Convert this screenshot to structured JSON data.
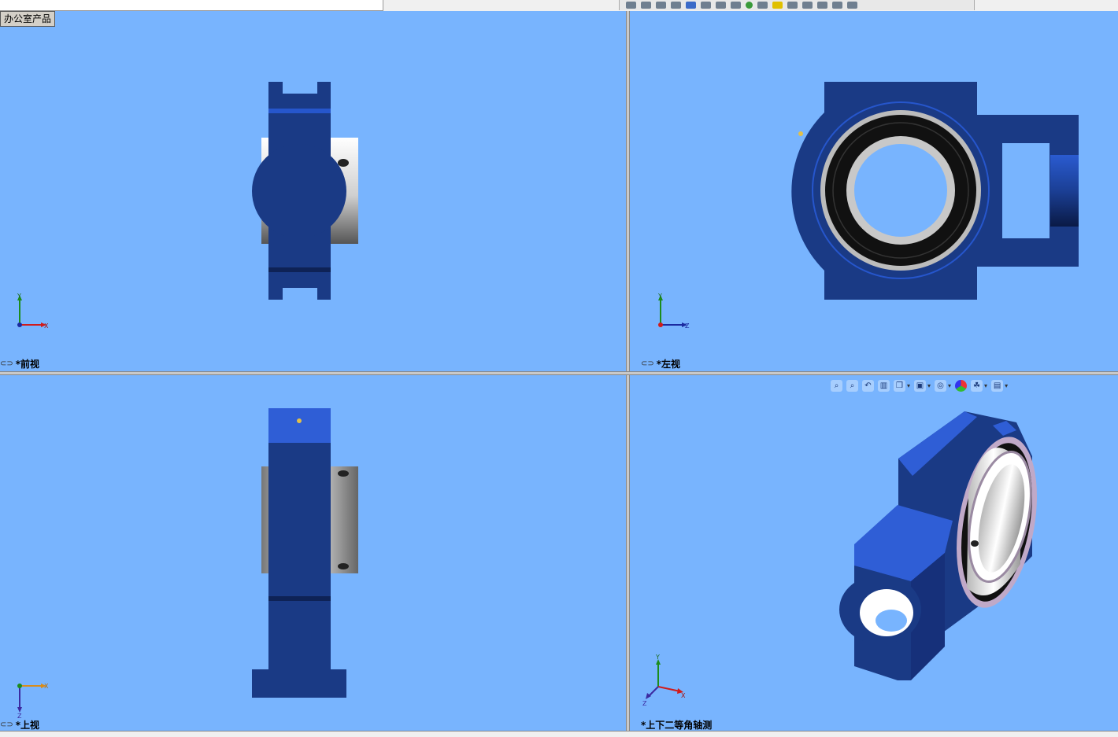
{
  "app": {
    "tag_label": "办公室产品"
  },
  "toolbar": {
    "icons": [
      "view-orient-icon",
      "section-icon",
      "display-icon",
      "hide-show-icon",
      "edit-appearance-icon",
      "scene-icon",
      "light-icon",
      "camera-icon",
      "measure-icon",
      "insert-icon",
      "zoom-icon",
      "pan-icon",
      "copy-icon",
      "paste-icon",
      "print-icon",
      "window-icon"
    ]
  },
  "viewports": {
    "front": {
      "label": "*前视",
      "axes": {
        "up": "Y",
        "right": "X"
      }
    },
    "left": {
      "label": "*左视",
      "axes": {
        "up": "Y",
        "right": "Z"
      }
    },
    "top": {
      "label": "*上视",
      "axes": {
        "right": "X",
        "down": "Z"
      }
    },
    "iso": {
      "label": "*上下二等角轴测",
      "axes": {
        "up": "Y",
        "right": "X",
        "left": "Z"
      }
    }
  },
  "heads_up_toolbar": {
    "items": [
      "zoom-to-fit-icon",
      "zoom-area-icon",
      "previous-view-icon",
      "section-view-icon",
      "view-orientation-icon",
      "display-style-icon",
      "hide-show-items-icon",
      "edit-appearance-icon",
      "apply-scene-icon",
      "view-settings-icon"
    ]
  },
  "colors": {
    "viewport_bg": "#78b4fe",
    "part_blue": "#1a3a85",
    "part_blue_light": "#2f5ed6",
    "bearing_black": "#111111",
    "bearing_silver": "#d0d0d0"
  }
}
